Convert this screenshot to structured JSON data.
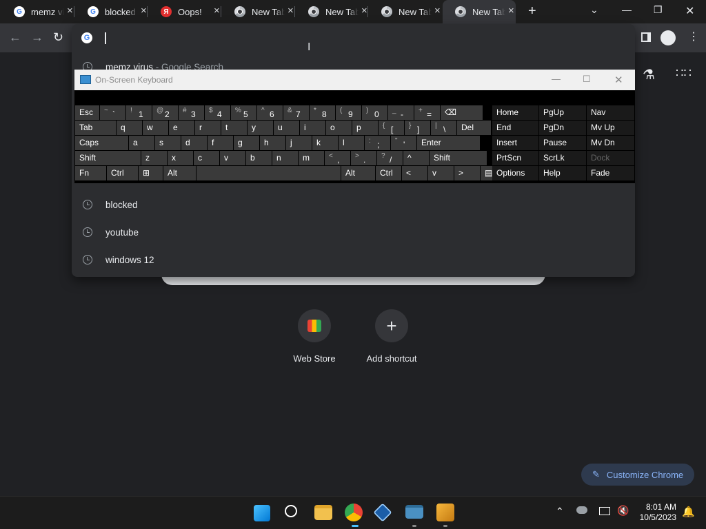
{
  "tabs": [
    {
      "title": "memz virus - Google Search",
      "favicon": "google-icon"
    },
    {
      "title": "blocked - Google Search",
      "favicon": "google-icon"
    },
    {
      "title": "Oops!",
      "favicon": "yandex-icon"
    },
    {
      "title": "New Tab",
      "favicon": "chrome-icon"
    },
    {
      "title": "New Tab",
      "favicon": "chrome-icon"
    },
    {
      "title": "New Tab",
      "favicon": "chrome-icon"
    },
    {
      "title": "New Tab",
      "favicon": "chrome-icon",
      "active": true
    }
  ],
  "new_tab_symbol": "+",
  "omnibox": {
    "value": "",
    "suggestions": [
      {
        "text": "memz virus",
        "sub": " - Google Search"
      },
      {
        "text": "blocked"
      },
      {
        "text": "youtube"
      },
      {
        "text": "windows 12"
      }
    ]
  },
  "shortcuts": [
    {
      "label": "Web Store",
      "icon": "web-store-icon"
    },
    {
      "label": "Add shortcut",
      "icon": "plus-icon",
      "symbol": "+"
    }
  ],
  "customize_label": "Customize Chrome",
  "osk": {
    "title": "On-Screen Keyboard",
    "row1": [
      {
        "label": "Esc"
      },
      {
        "shift": "~",
        "main": "`"
      },
      {
        "shift": "!",
        "main": "1"
      },
      {
        "shift": "@",
        "main": "2"
      },
      {
        "shift": "#",
        "main": "3"
      },
      {
        "shift": "$",
        "main": "4"
      },
      {
        "shift": "%",
        "main": "5"
      },
      {
        "shift": "^",
        "main": "6"
      },
      {
        "shift": "&",
        "main": "7"
      },
      {
        "shift": "*",
        "main": "8"
      },
      {
        "shift": "(",
        "main": "9"
      },
      {
        "shift": ")",
        "main": "0"
      },
      {
        "shift": "_",
        "main": "-"
      },
      {
        "shift": "+",
        "main": "="
      },
      {
        "label": "⌫"
      }
    ],
    "row2": [
      {
        "label": "Tab"
      },
      {
        "label": "q"
      },
      {
        "label": "w"
      },
      {
        "label": "e"
      },
      {
        "label": "r"
      },
      {
        "label": "t"
      },
      {
        "label": "y"
      },
      {
        "label": "u"
      },
      {
        "label": "i"
      },
      {
        "label": "o"
      },
      {
        "label": "p"
      },
      {
        "shift": "{",
        "main": "["
      },
      {
        "shift": "}",
        "main": "]"
      },
      {
        "shift": "|",
        "main": "\\"
      },
      {
        "label": "Del"
      }
    ],
    "row3": [
      {
        "label": "Caps"
      },
      {
        "label": "a"
      },
      {
        "label": "s"
      },
      {
        "label": "d"
      },
      {
        "label": "f"
      },
      {
        "label": "g"
      },
      {
        "label": "h"
      },
      {
        "label": "j"
      },
      {
        "label": "k"
      },
      {
        "label": "l"
      },
      {
        "shift": ":",
        "main": ";"
      },
      {
        "shift": "\"",
        "main": "'"
      },
      {
        "label": "Enter"
      }
    ],
    "row4": [
      {
        "label": "Shift"
      },
      {
        "label": "z"
      },
      {
        "label": "x"
      },
      {
        "label": "c"
      },
      {
        "label": "v"
      },
      {
        "label": "b"
      },
      {
        "label": "n"
      },
      {
        "label": "m"
      },
      {
        "shift": "<",
        "main": ","
      },
      {
        "shift": ">",
        "main": "."
      },
      {
        "shift": "?",
        "main": "/"
      },
      {
        "label": "^"
      },
      {
        "label": "Shift"
      }
    ],
    "row5": [
      {
        "label": "Fn"
      },
      {
        "label": "Ctrl"
      },
      {
        "label": "⊞"
      },
      {
        "label": "Alt"
      },
      {
        "label": ""
      },
      {
        "label": "Alt"
      },
      {
        "label": "Ctrl"
      },
      {
        "label": "<"
      },
      {
        "label": "v"
      },
      {
        "label": ">"
      },
      {
        "label": "▤"
      }
    ],
    "nav_rows": [
      [
        "Home",
        "PgUp",
        "Nav"
      ],
      [
        "End",
        "PgDn",
        "Mv Up"
      ],
      [
        "Insert",
        "Pause",
        "Mv Dn"
      ],
      [
        "PrtScn",
        "ScrLk",
        "Dock"
      ],
      [
        "Options",
        "Help",
        "Fade"
      ]
    ]
  },
  "clock": {
    "time": "8:01 AM",
    "date": "10/5/2023"
  },
  "colors": {
    "accent": "#8ab4f8",
    "bg": "#202124",
    "osk_key": "#3a3a3a"
  }
}
